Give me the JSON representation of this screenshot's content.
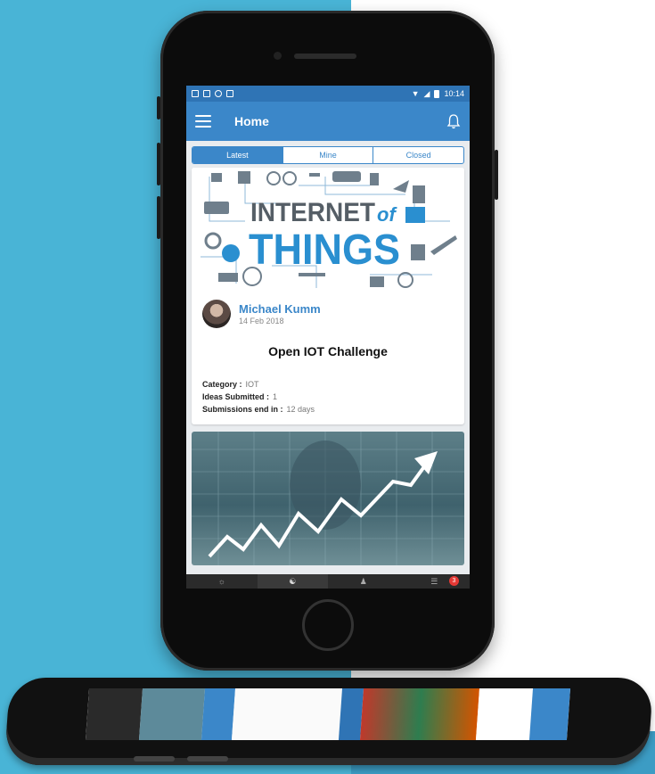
{
  "status_bar": {
    "time": "10:14"
  },
  "app_bar": {
    "title": "Home"
  },
  "tabs": [
    {
      "label": "Latest",
      "active": true
    },
    {
      "label": "Mine",
      "active": false
    },
    {
      "label": "Closed",
      "active": false
    }
  ],
  "post": {
    "banner": {
      "line1": "INTERNET",
      "of": "of",
      "line2": "THINGS"
    },
    "author": "Michael Kumm",
    "date": "14 Feb 2018",
    "title": "Open IOT Challenge",
    "meta": [
      {
        "label": "Category :",
        "value": "IOT"
      },
      {
        "label": "Ideas Submitted :",
        "value": "1"
      },
      {
        "label": "Submissions end in :",
        "value": "12 days"
      }
    ]
  },
  "bottom_nav": {
    "badge_count": "3"
  },
  "colors": {
    "primary": "#3b87c9",
    "status_bar": "#2f74b5",
    "background": "#49b4d6"
  }
}
